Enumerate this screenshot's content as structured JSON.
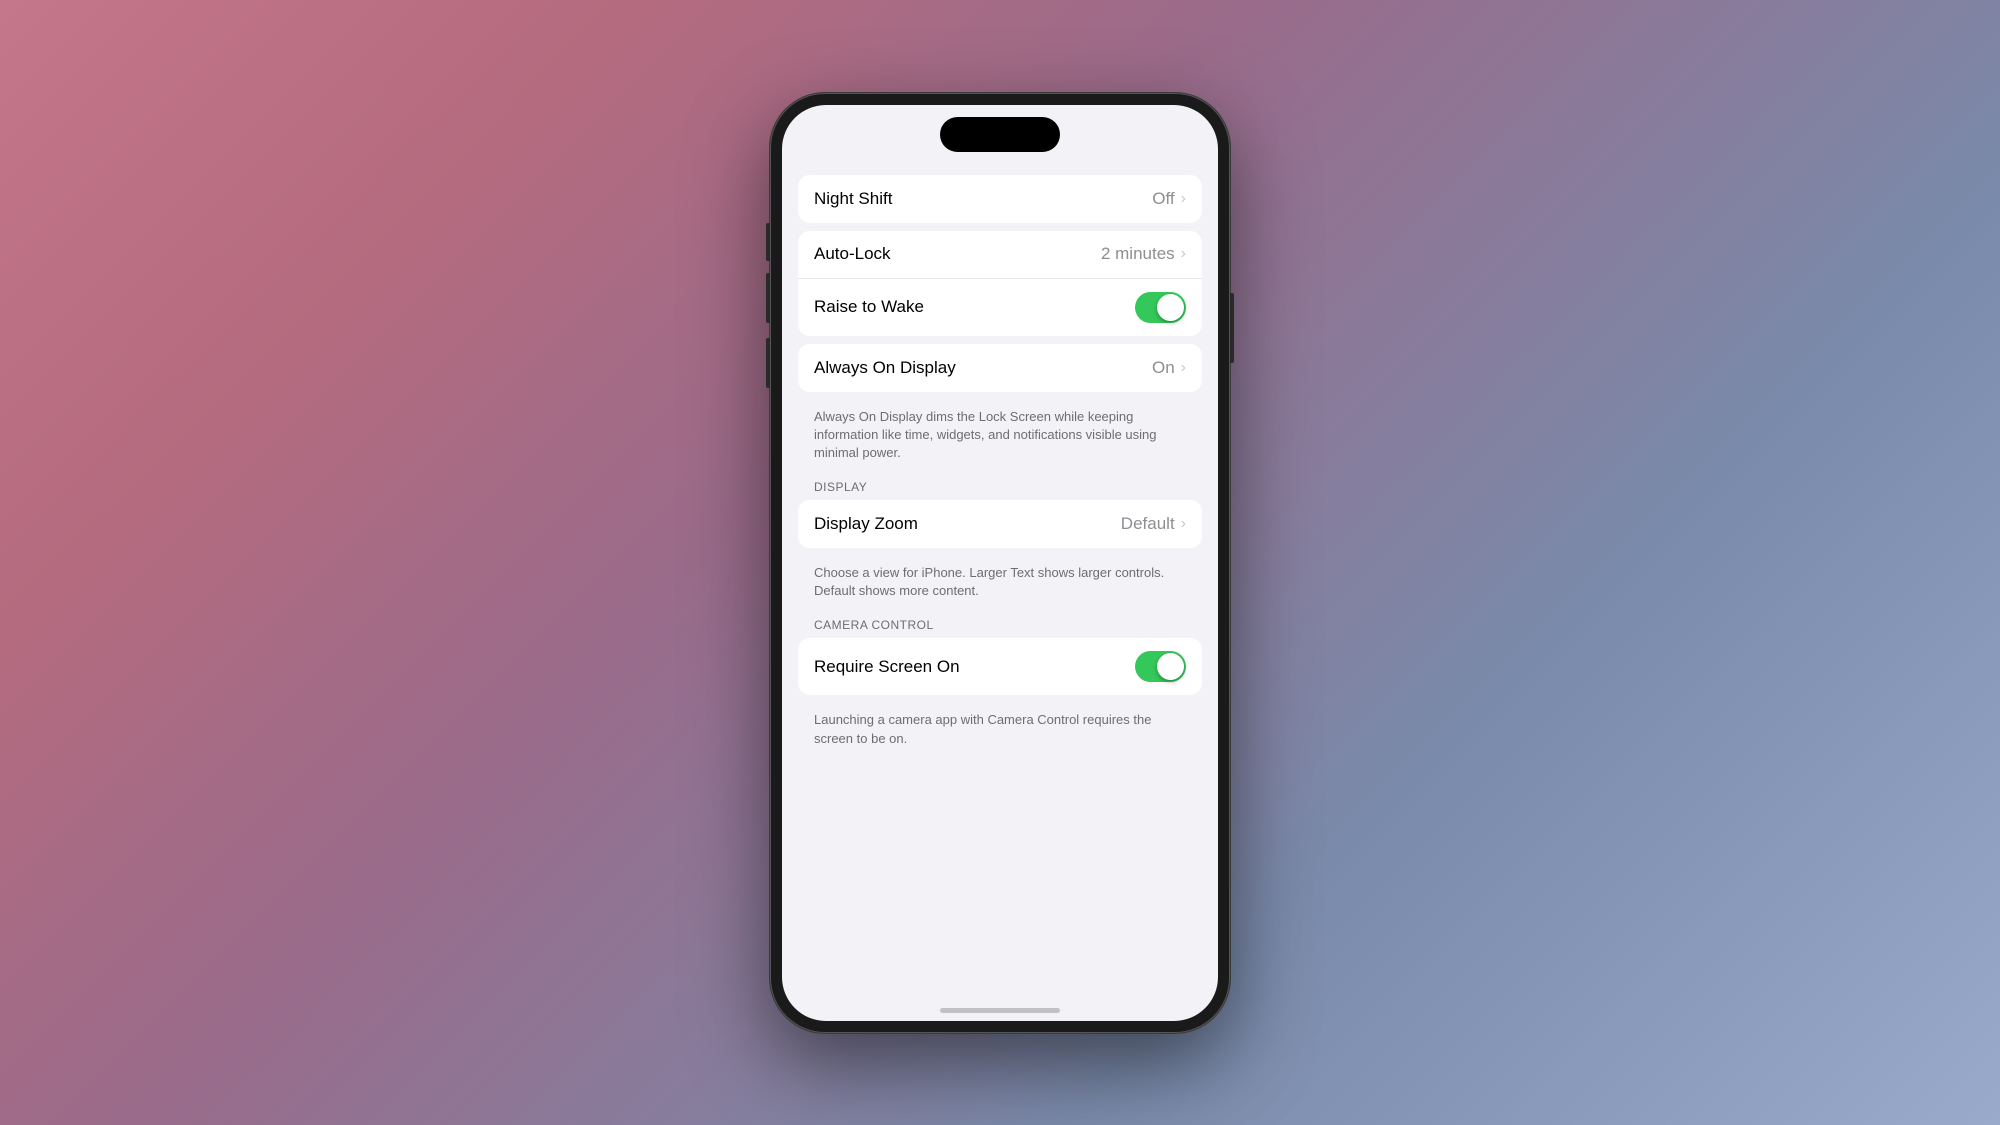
{
  "background": {
    "gradient_start": "#c4768a",
    "gradient_end": "#9aaaca"
  },
  "phone": {
    "frame_color": "#1a1a1a",
    "screen_bg": "#f2f2f7"
  },
  "settings": {
    "sections": [
      {
        "id": "night-shift-section",
        "rows": [
          {
            "id": "night-shift",
            "label": "Night Shift",
            "value": "Off",
            "type": "link",
            "has_chevron": true
          }
        ]
      },
      {
        "id": "lock-section",
        "rows": [
          {
            "id": "auto-lock",
            "label": "Auto-Lock",
            "value": "2 minutes",
            "type": "link",
            "has_chevron": true
          },
          {
            "id": "raise-to-wake",
            "label": "Raise to Wake",
            "value": null,
            "type": "toggle",
            "toggle_on": true
          }
        ]
      },
      {
        "id": "always-on-section",
        "rows": [
          {
            "id": "always-on-display",
            "label": "Always On Display",
            "value": "On",
            "type": "link",
            "has_chevron": true
          }
        ],
        "description": "Always On Display dims the Lock Screen while keeping information like time, widgets, and notifications visible using minimal power."
      },
      {
        "id": "display-section",
        "header": "DISPLAY",
        "rows": [
          {
            "id": "display-zoom",
            "label": "Display Zoom",
            "value": "Default",
            "type": "link",
            "has_chevron": true
          }
        ],
        "description": "Choose a view for iPhone. Larger Text shows larger controls. Default shows more content."
      },
      {
        "id": "camera-control-section",
        "header": "CAMERA CONTROL",
        "rows": [
          {
            "id": "require-screen-on",
            "label": "Require Screen On",
            "value": null,
            "type": "toggle",
            "toggle_on": true
          }
        ],
        "description": "Launching a camera app with Camera Control requires the screen to be on."
      }
    ]
  }
}
